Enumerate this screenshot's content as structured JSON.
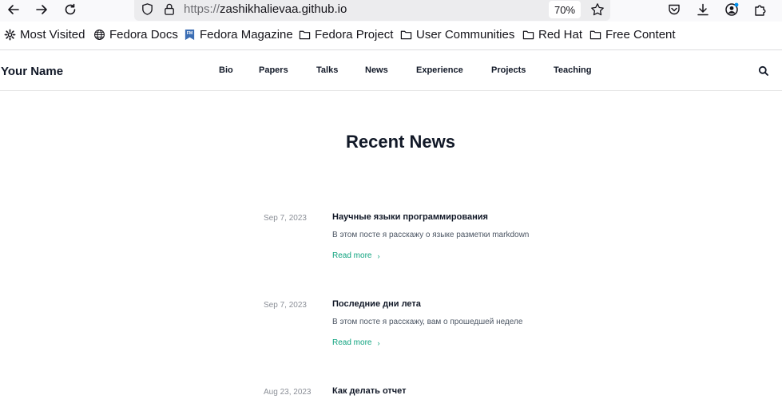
{
  "browser": {
    "url_protocol": "https://",
    "url_host": "zashikhalievaa.github.io",
    "zoom": "70%"
  },
  "bookmarks": [
    {
      "label": "Most Visited",
      "icon": "gear-icon"
    },
    {
      "label": "Fedora Docs",
      "icon": "globe-icon"
    },
    {
      "label": "Fedora Magazine",
      "icon": "fedora-magazine-icon"
    },
    {
      "label": "Fedora Project",
      "icon": "folder-icon"
    },
    {
      "label": "User Communities",
      "icon": "folder-icon"
    },
    {
      "label": "Red Hat",
      "icon": "folder-icon"
    },
    {
      "label": "Free Content",
      "icon": "folder-icon"
    }
  ],
  "site": {
    "brand": "Your Name",
    "nav": [
      "Bio",
      "Papers",
      "Talks",
      "News",
      "Experience",
      "Projects",
      "Teaching"
    ]
  },
  "page": {
    "title": "Recent News",
    "read_more": "Read more",
    "posts": [
      {
        "date": "Sep 7, 2023",
        "title": "Научные языки программирования",
        "summary": "В этом посте я расскажу о языке разметки markdown"
      },
      {
        "date": "Sep 7, 2023",
        "title": "Последние дни лета",
        "summary": "В этом посте я расскажу, вам о прошедшей неделе"
      },
      {
        "date": "Aug 23, 2023",
        "title": "Как делать отчет",
        "summary": ""
      }
    ]
  },
  "colors": {
    "accent": "#0fa37f",
    "text": "#111827",
    "muted": "#8b8f97"
  }
}
